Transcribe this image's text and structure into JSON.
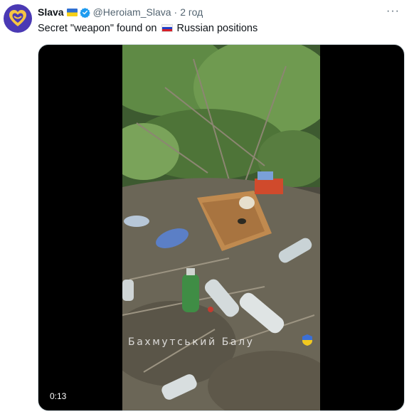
{
  "tweet": {
    "author_name": "Slava",
    "author_handle": "@Heroiam_Slava",
    "separator": "·",
    "time": "2 год",
    "text_before_flag": "Secret \"weapon\" found on ",
    "text_after_flag": " Russian positions",
    "menu_label": "···"
  },
  "icons": {
    "avatar": "heart-logo-icon",
    "author_flag": "ukraine-flag-icon",
    "verified": "verified-badge-icon",
    "text_flag": "russia-flag-icon",
    "menu": "more-options-icon"
  },
  "media": {
    "watermark": "Бахмутський Балу",
    "timecode": "0:13"
  },
  "colors": {
    "avatar_bg": "#4a39b4",
    "verified_blue": "#1d9bf0",
    "muted_text": "#536471"
  }
}
